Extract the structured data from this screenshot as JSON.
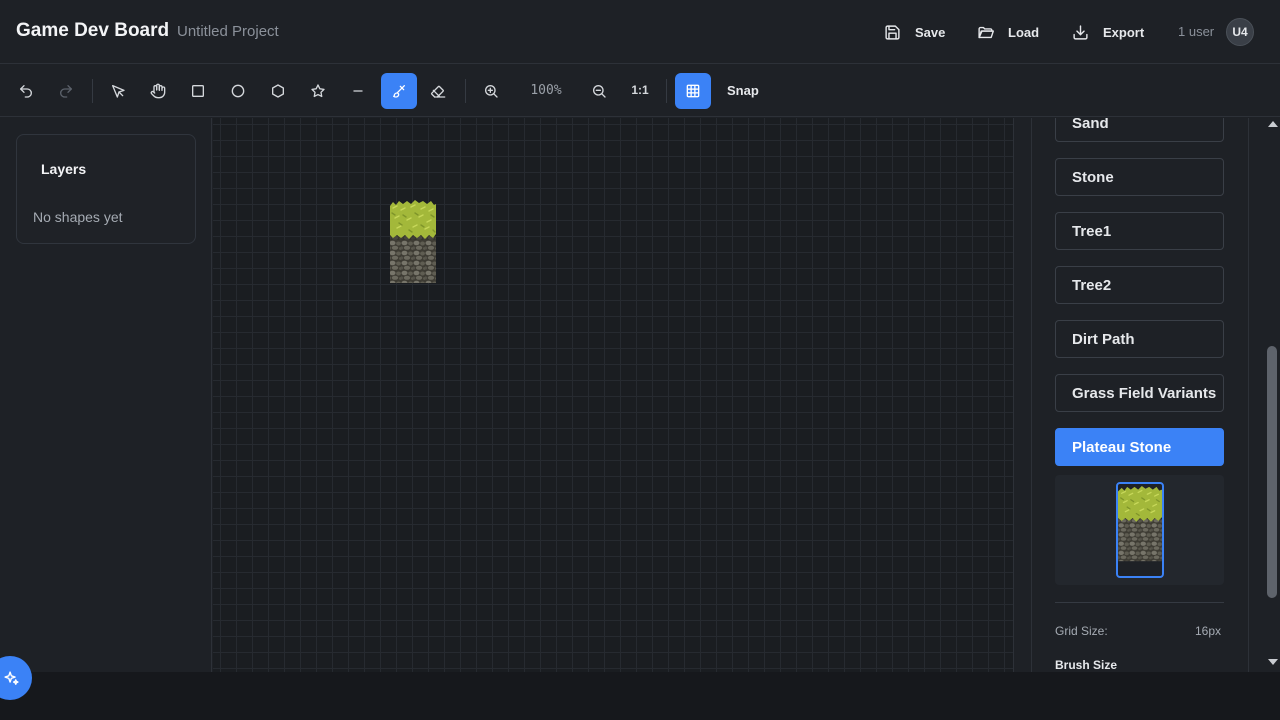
{
  "header": {
    "title": "Game Dev Board",
    "project": "Untitled Project",
    "save_label": "Save",
    "load_label": "Load",
    "export_label": "Export",
    "user_count": "1 user",
    "avatar_initials": "U4"
  },
  "toolbar": {
    "zoom": "100%",
    "ratio_label": "1:1",
    "snap_label": "Snap",
    "tools": [
      "undo-icon",
      "redo-icon",
      "select-arrow-icon",
      "hand-icon",
      "rectangle-icon",
      "circle-icon",
      "hexagon-icon",
      "star-icon",
      "line-icon",
      "paint-brush-icon",
      "eraser-icon",
      "zoom-in-icon",
      "zoom-out-icon",
      "grid-icon"
    ],
    "active_tools": [
      "paint-brush-icon",
      "grid-icon"
    ]
  },
  "layers": {
    "title": "Layers",
    "empty_text": "No shapes yet"
  },
  "tilesets": {
    "items": [
      {
        "label": "Sand",
        "active": false
      },
      {
        "label": "Stone",
        "active": false
      },
      {
        "label": "Tree1",
        "active": false
      },
      {
        "label": "Tree2",
        "active": false
      },
      {
        "label": "Dirt Path",
        "active": false
      },
      {
        "label": "Grass Field Variants",
        "active": false
      },
      {
        "label": "Plateau Stone",
        "active": true
      }
    ]
  },
  "settings": {
    "grid_size_label": "Grid Size:",
    "grid_size_value": "16px",
    "brush_size_label": "Brush Size"
  },
  "colors": {
    "accent": "#3b82f6",
    "background": "#1e2126",
    "canvas": "#1a1d21",
    "grass": "#a9bf3f",
    "stone": "#5c5a4f"
  }
}
